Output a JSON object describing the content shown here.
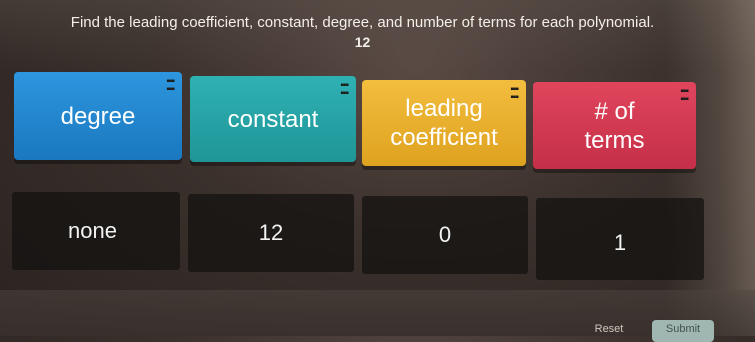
{
  "question": {
    "prompt": "Find the leading coefficient, constant, degree, and number of terms for each polynomial.",
    "polynomial": "12"
  },
  "tiles": [
    {
      "label": "degree",
      "color": "#2d96de"
    },
    {
      "label": "constant",
      "color": "#2fb1b3"
    },
    {
      "label": "leading coefficient",
      "color": "#f3bd3e"
    },
    {
      "label": "# of terms",
      "color": "#e0455c"
    }
  ],
  "answers": [
    "none",
    "12",
    "0",
    "1"
  ],
  "buttons": {
    "reset": "Reset",
    "submit": "Submit"
  }
}
